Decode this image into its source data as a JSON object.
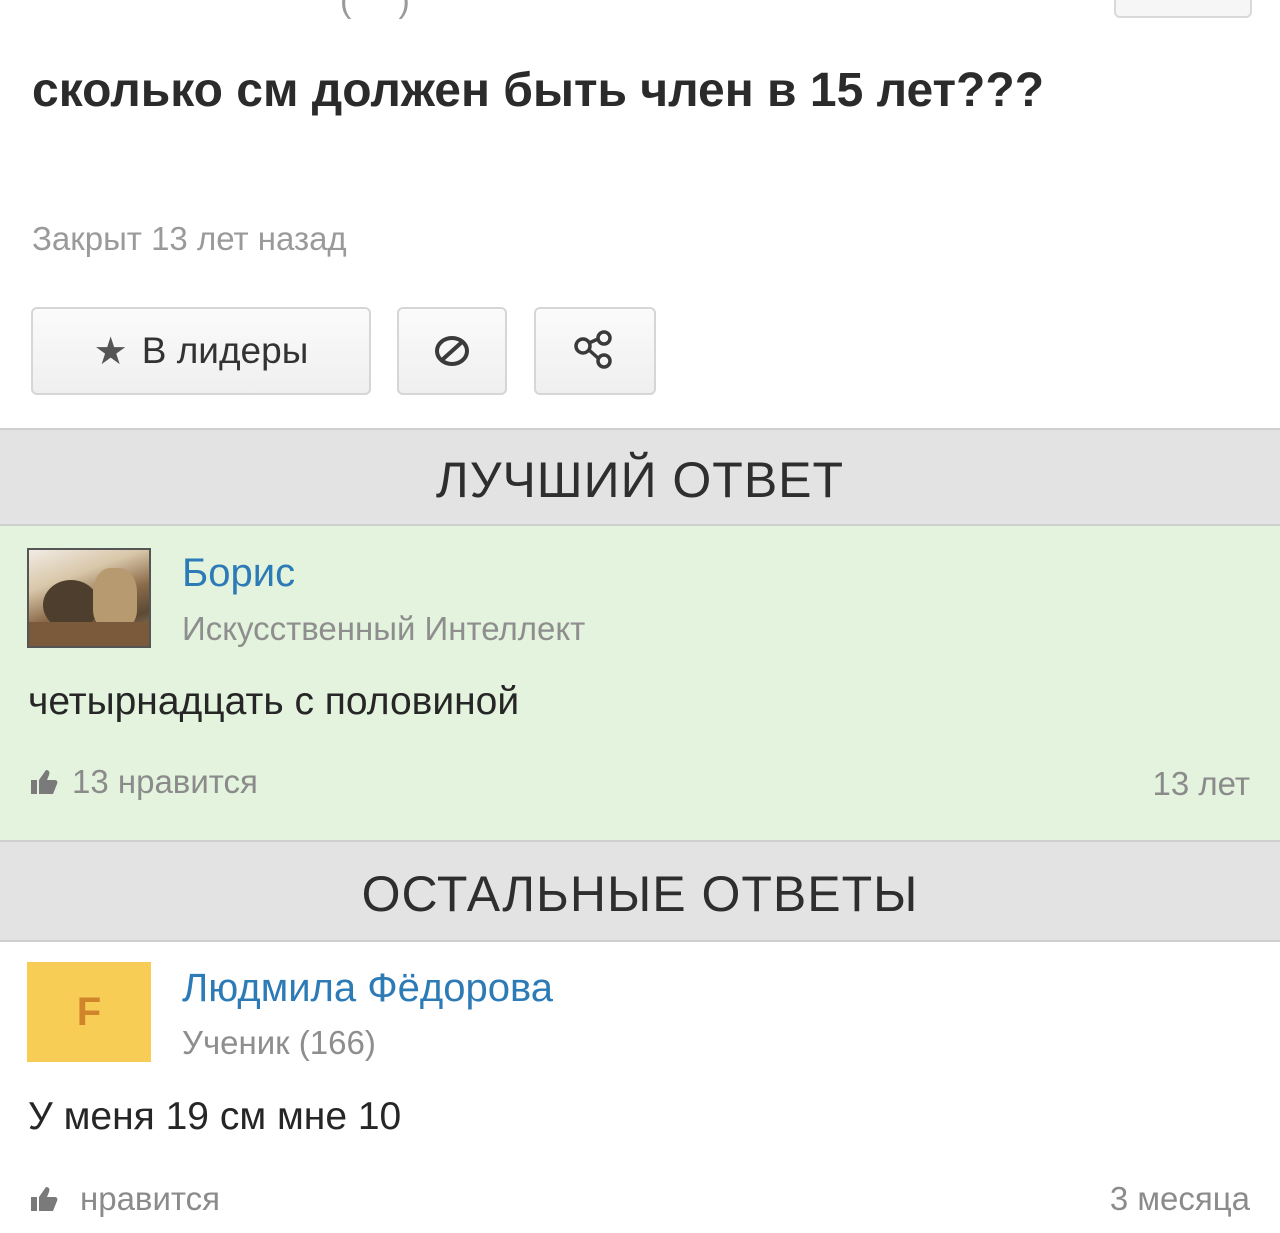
{
  "question": {
    "title": "сколько см должен быть член в 15 лет???",
    "status": "Закрыт 13 лет назад"
  },
  "actions": {
    "leaders_label": "В лидеры",
    "leaders_icon": "star-icon",
    "report_icon": "block-icon",
    "share_icon": "share-icon"
  },
  "best_answer": {
    "header": "ЛУЧШИЙ ОТВЕТ",
    "author": "Борис",
    "rank": "Искусственный Интеллект",
    "text": "четырнадцать с половиной",
    "likes": "13 нравится",
    "time": "13 лет",
    "background": "#e3f3de"
  },
  "other_answers": {
    "header": "ОСТАЛЬНЫЕ ОТВЕТЫ",
    "items": [
      {
        "avatar_letter": "F",
        "author": "Людмила Фёдорова",
        "rank": "Ученик (166)",
        "text": "У меня 19 см мне 10",
        "likes": "нравится",
        "time": "3 месяца"
      }
    ]
  },
  "colors": {
    "link": "#2d7bb6",
    "muted": "#8e8e8e",
    "header_bg": "#e3e3e3",
    "avatar_yellow": "#f8cd55"
  }
}
